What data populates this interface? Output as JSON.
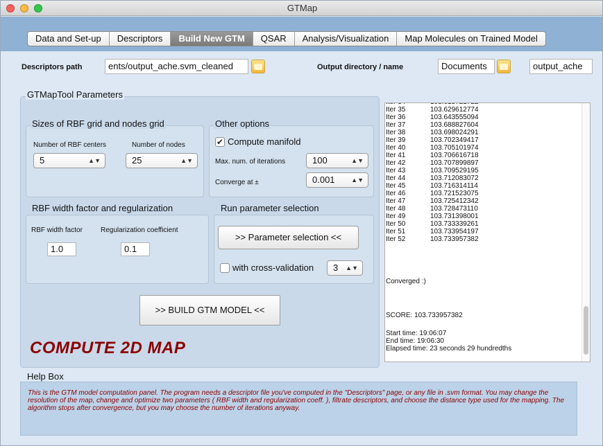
{
  "window": {
    "title": "GTMap"
  },
  "tabs": [
    {
      "label": "Data and Set-up",
      "active": false
    },
    {
      "label": "Descriptors",
      "active": false
    },
    {
      "label": "Build New GTM",
      "active": true
    },
    {
      "label": "QSAR",
      "active": false
    },
    {
      "label": "Analysis/Visualization",
      "active": false
    },
    {
      "label": "Map Molecules on Trained Model",
      "active": false
    }
  ],
  "paths": {
    "descriptors_label": "Descriptors path",
    "descriptors_value": "ents/output_ache.svm_cleaned",
    "output_label": "Output directory / name",
    "output_dir": "Documents",
    "output_name": "output_ache"
  },
  "params": {
    "title": "GTMapTool Parameters",
    "sizes": {
      "title": "Sizes of RBF grid and nodes grid",
      "rbf_label": "Number of RBF centers",
      "rbf_value": "5",
      "nodes_label": "Number of nodes",
      "nodes_value": "25"
    },
    "other": {
      "title": "Other options",
      "compute_manifold_label": "Compute manifold",
      "compute_manifold_checked": true,
      "max_iter_label": "Max. num. of iterations",
      "max_iter_value": "100",
      "converge_label": "Converge at ±",
      "converge_value": "0.001"
    },
    "rbfwidth": {
      "title": "RBF width factor and regularization",
      "width_label": "RBF width factor",
      "width_value": "1.0",
      "reg_label": "Regularization coefficient",
      "reg_value": "0.1"
    },
    "runsel": {
      "title": "Run parameter selection",
      "button_label": ">> Parameter selection <<",
      "crossval_label": "with cross-validation",
      "crossval_checked": false,
      "folds_value": "3"
    },
    "build_button": ">> BUILD GTM MODEL <<"
  },
  "compute_title": "COMPUTE 2D MAP",
  "log": {
    "rows": [
      {
        "iter": "Iter 35",
        "value": "103.629612774"
      },
      {
        "iter": "Iter 36",
        "value": "103.643555094"
      },
      {
        "iter": "Iter 37",
        "value": "103.688827604"
      },
      {
        "iter": "Iter 38",
        "value": "103.698024291"
      },
      {
        "iter": "Iter 39",
        "value": "103.702349417"
      },
      {
        "iter": "Iter 40",
        "value": "103.705101974"
      },
      {
        "iter": "Iter 41",
        "value": "103.706616718"
      },
      {
        "iter": "Iter 42",
        "value": "103.707899897"
      },
      {
        "iter": "Iter 43",
        "value": "103.709529195"
      },
      {
        "iter": "Iter 44",
        "value": "103.712083072"
      },
      {
        "iter": "Iter 45",
        "value": "103.716314114"
      },
      {
        "iter": "Iter 46",
        "value": "103.721523075"
      },
      {
        "iter": "Iter 47",
        "value": "103.725412342"
      },
      {
        "iter": "Iter 48",
        "value": "103.728473110"
      },
      {
        "iter": "Iter 49",
        "value": "103.731398001"
      },
      {
        "iter": "Iter 50",
        "value": "103.733339261"
      },
      {
        "iter": "Iter 51",
        "value": "103.733954197"
      },
      {
        "iter": "Iter 52",
        "value": "103.733957382"
      }
    ],
    "converged": "Converged :)",
    "score": "SCORE: 103.733957382",
    "start_time": "Start time: 19:06:07",
    "end_time": "End time: 19:06:30",
    "elapsed": "Elapsed time: 23 seconds 29 hundredths"
  },
  "help": {
    "title": "Help Box",
    "text": "This is the GTM model computation panel. The program needs a descriptor file  you've computed in the \"Descriptors\" page, or any file in .svm format. You may change the resolution of the map, change and optimize two parameters ( RBF width and regularization coeff. ), filtrate descriptors, and choose the distance type used for the mapping. The algorithm stops after convergence, but you may choose the number of iterations anyway."
  },
  "colors": {
    "accent_red": "#8b0000",
    "strip_blue": "#8fb1d4",
    "panel_blue": "#d4e1ee"
  }
}
